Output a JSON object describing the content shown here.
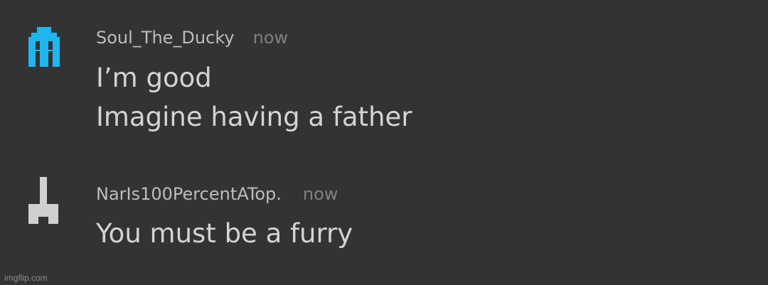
{
  "messages": [
    {
      "username": "Soul_The_Ducky",
      "timestamp": "now",
      "lines": [
        "I’m good",
        "Imagine having a father"
      ],
      "avatar": {
        "icon": "cyan-pixel-ghost-icon",
        "color": "#1fb6f0"
      }
    },
    {
      "username": "NarIs100PercentATop.",
      "timestamp": "now",
      "lines": [
        "You must be a furry"
      ],
      "avatar": {
        "icon": "gray-pixel-figure-icon",
        "color": "#d0d0d0"
      }
    }
  ],
  "watermark": "imgflip.com"
}
